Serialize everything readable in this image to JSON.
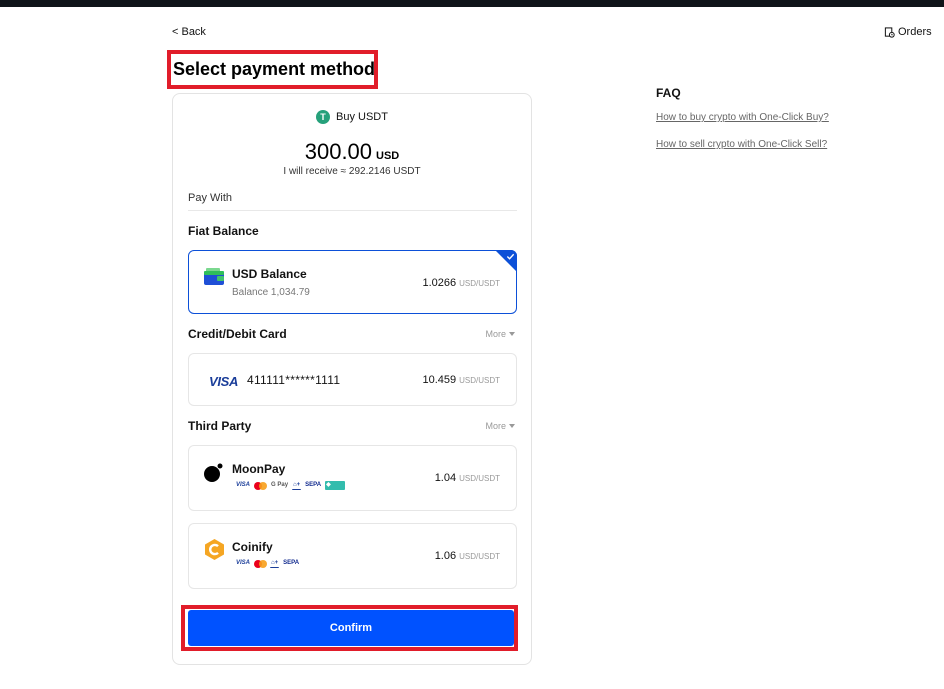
{
  "nav": {
    "back_label": "< Back",
    "orders_label": "Orders"
  },
  "page": {
    "title": "Select payment method"
  },
  "order": {
    "buy_label": "Buy USDT",
    "amount": "300.00",
    "amount_currency": "USD",
    "receive_text": "I will receive ≈ 292.2146 USDT"
  },
  "pay_with_label": "Pay With",
  "fiat_section": {
    "title": "Fiat Balance",
    "option": {
      "name": "USD Balance",
      "balance": "Balance 1,034.79",
      "rate": "1.0266",
      "rate_unit": "USD/USDT",
      "selected": true
    }
  },
  "card_section": {
    "title": "Credit/Debit Card",
    "more_label": "More",
    "option": {
      "brand": "VISA",
      "number": "411111******1111",
      "rate": "10.459",
      "rate_unit": "USD/USDT"
    }
  },
  "third_party_section": {
    "title": "Third Party",
    "more_label": "More",
    "options": [
      {
        "name": "MoonPay",
        "rate": "1.04",
        "rate_unit": "USD/USDT",
        "logos": [
          "VISA",
          "mastercard",
          "G Pay",
          "bank",
          "SEPA",
          "pix"
        ]
      },
      {
        "name": "Coinify",
        "rate": "1.06",
        "rate_unit": "USD/USDT",
        "logos": [
          "VISA",
          "mastercard",
          "bank",
          "SEPA"
        ]
      }
    ]
  },
  "confirm_label": "Confirm",
  "faq": {
    "title": "FAQ",
    "links": [
      "How to buy crypto with One-Click Buy?",
      "How to sell crypto with One-Click Sell?"
    ]
  },
  "colors": {
    "accent": "#0052ff",
    "highlight_box": "#e11d2a",
    "selected_border": "#0c50d8",
    "tether": "#26a17b"
  }
}
